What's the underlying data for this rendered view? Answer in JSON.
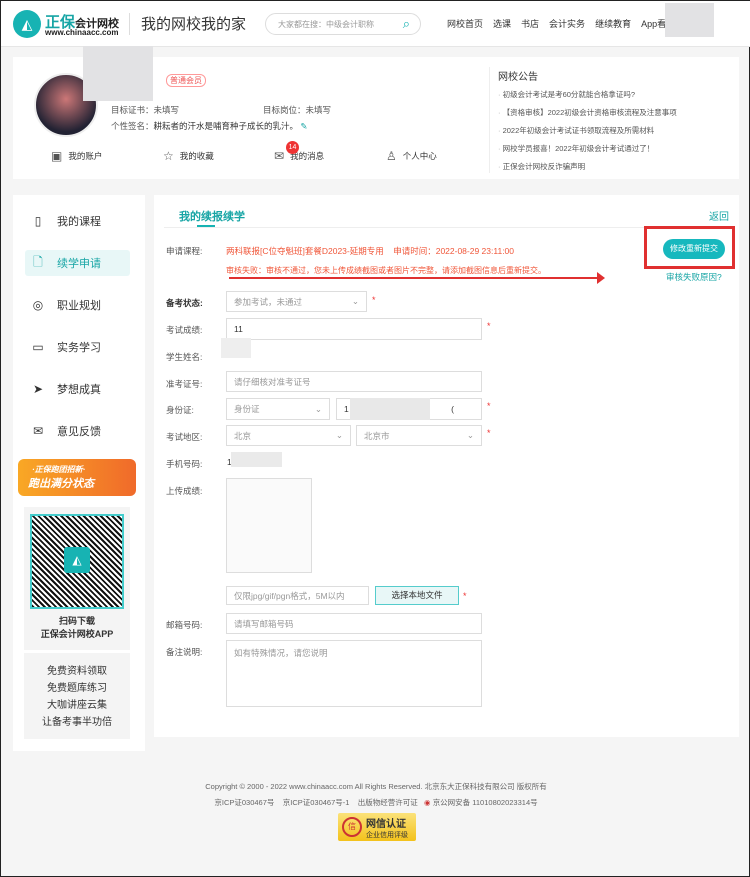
{
  "header": {
    "logo_icon": "chinaacc-logo",
    "brand": "正保",
    "brand_sub": "会计网校",
    "url": "www.chinaacc.com",
    "slogan": "我的网校我的家",
    "search_placeholder": "大家都在搜：中级会计职称",
    "nav": [
      "网校首页",
      "选课",
      "书店",
      "会计实务",
      "继续教育",
      "App看课"
    ]
  },
  "profile": {
    "member_badge": "普通会员",
    "target_cert_label": "目标证书：",
    "target_cert": "未填写",
    "target_job_label": "目标岗位：",
    "target_job": "未填写",
    "signature_label": "个性签名：",
    "signature": "耕耘者的汗水是哺育种子成长的乳汁。",
    "quick_links": [
      {
        "label": "我的账户",
        "icon": "wallet-icon"
      },
      {
        "label": "我的收藏",
        "icon": "star-icon"
      },
      {
        "label": "我的消息",
        "icon": "mail-icon",
        "badge": "14"
      },
      {
        "label": "个人中心",
        "icon": "user-icon"
      }
    ]
  },
  "notices": {
    "title": "网校公告",
    "items": [
      "初级会计考试是考60分就能合格拿证吗?",
      "【资格审核】2022初级会计资格审核流程及注意事项",
      "2022年初级会计考试证书领取流程及所需材料",
      "网校学员报喜！2022年初级会计考试通过了！",
      "正保会计网校反诈骗声明"
    ]
  },
  "sidebar": {
    "items": [
      {
        "label": "我的课程",
        "icon": "book-icon"
      },
      {
        "label": "续学申请",
        "icon": "document-icon",
        "active": true
      },
      {
        "label": "职业规划",
        "icon": "compass-icon"
      },
      {
        "label": "实务学习",
        "icon": "monitor-icon"
      },
      {
        "label": "梦想成真",
        "icon": "send-icon"
      },
      {
        "label": "意见反馈",
        "icon": "mail-icon"
      }
    ],
    "promo_line1": "·正保跑团招新·",
    "promo_line2": "跑出满分状态",
    "qr_title1": "扫码下载",
    "qr_title2": "正保会计网校APP",
    "links": [
      "免费资料领取",
      "免费题库练习",
      "大咖讲座云集",
      "让备考事半功倍"
    ]
  },
  "main": {
    "title": "我的续报续学",
    "back": "返回",
    "course_label": "申请课程:",
    "course": "两科联报[C位夺魁班]套餐D2023-延期专用",
    "apply_time_label": "申请时间：",
    "apply_time": "2022-08-29 23:11:00",
    "fail_msg": "审核失败：审核不通过，您未上传成绩截图或者图片不完整，请添加截图信息后重新提交。",
    "resubmit": "修改重新提交",
    "fail_reason": "审核失败原因?",
    "form": {
      "status_label": "备考状态:",
      "status_value": "参加考试，未通过",
      "score_label": "考试成绩:",
      "score_value": "11",
      "name_label": "学生姓名:",
      "ticket_label": "准考证号:",
      "ticket_placeholder": "请仔细核对准考证号",
      "id_label": "身份证:",
      "id_type": "身份证",
      "id_prefix": "1",
      "id_suffix": "(",
      "region_label": "考试地区:",
      "province": "北京",
      "city": "北京市",
      "phone_label": "手机号码:",
      "phone_prefix": "1",
      "upload_label": "上传成绩:",
      "file_placeholder": "仅限jpg/gif/pgn格式，5M以内",
      "choose_file": "选择本地文件",
      "email_label": "邮箱号码:",
      "email_placeholder": "请填写邮箱号码",
      "remark_label": "备注说明:",
      "remark_placeholder": "如有特殊情况，请您说明",
      "required": "*"
    }
  },
  "footer": {
    "copyright": "Copyright © 2000 - 2022 www.chinaacc.com All Rights Reserved.   北京东大正保科技有限公司 版权所有",
    "icp1": "京ICP证030467号",
    "icp2": "京ICP证030467号-1",
    "publish": "出版物经营许可证",
    "police": "京公网安备 11010802023314号",
    "cert_title": "网信认证",
    "cert_sub": "企业信用评级",
    "cert_seal": "信"
  }
}
